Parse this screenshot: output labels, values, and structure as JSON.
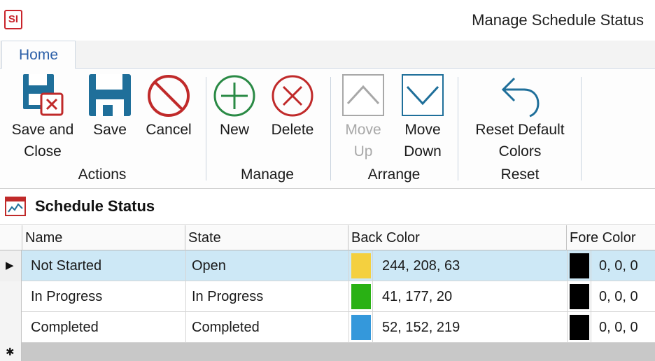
{
  "app": {
    "logo_text": "SI",
    "window_title": "Manage Schedule Status"
  },
  "tabs": [
    {
      "label": "Home"
    }
  ],
  "ribbon": {
    "groups": {
      "actions": "Actions",
      "manage": "Manage",
      "arrange": "Arrange",
      "reset": "Reset"
    },
    "buttons": {
      "save_and_close": [
        "Save and",
        "Close"
      ],
      "save": "Save",
      "cancel": "Cancel",
      "new": "New",
      "delete": "Delete",
      "move_up": [
        "Move",
        "Up"
      ],
      "move_down": [
        "Move",
        "Down"
      ],
      "reset_default_colors": [
        "Reset Default",
        "Colors"
      ]
    }
  },
  "section": {
    "title": "Schedule Status"
  },
  "grid": {
    "columns": [
      "Name",
      "State",
      "Back Color",
      "Fore Color"
    ],
    "rows": [
      {
        "name": "Not Started",
        "state": "Open",
        "back_color_text": "244, 208, 63",
        "back_color_hex": "#f4d03f",
        "fore_color_text": "0, 0, 0",
        "fore_color_hex": "#000000",
        "selected": true
      },
      {
        "name": "In Progress",
        "state": "In Progress",
        "back_color_text": "41, 177, 20",
        "back_color_hex": "#29b114",
        "fore_color_text": "0, 0, 0",
        "fore_color_hex": "#000000",
        "selected": false
      },
      {
        "name": "Completed",
        "state": "Completed",
        "back_color_text": "52, 152, 219",
        "back_color_hex": "#3498db",
        "fore_color_text": "0, 0, 0",
        "fore_color_hex": "#000000",
        "selected": false
      }
    ],
    "row_indicators": {
      "current": "▶",
      "new": "✱"
    }
  },
  "colors": {
    "accent_blue": "#2b5fa8",
    "icon_teal": "#1f6f9a",
    "icon_red": "#c02a2a",
    "icon_green": "#2a8a45",
    "selection": "#cde8f6"
  }
}
